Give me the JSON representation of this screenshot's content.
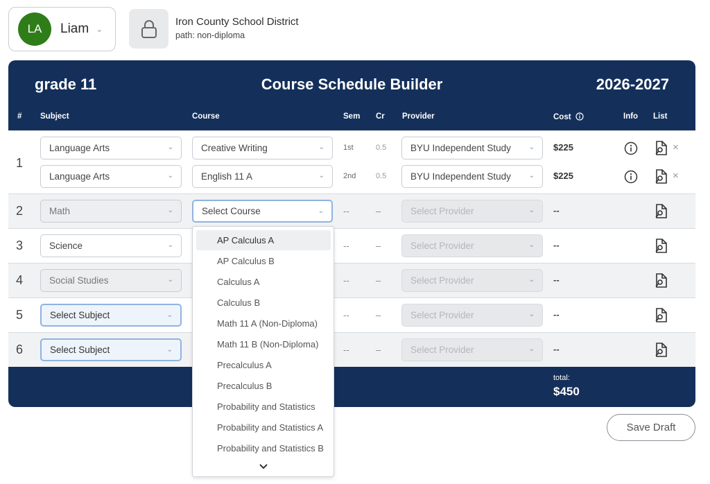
{
  "user": {
    "initials": "LA",
    "name": "Liam",
    "avatar_color": "#2f7d19"
  },
  "district": {
    "name": "Iron County School District",
    "path": "path: non-diploma"
  },
  "header": {
    "grade": "grade 11",
    "title": "Course Schedule Builder",
    "year": "2026-2027"
  },
  "columns": {
    "num": "#",
    "subject": "Subject",
    "course": "Course",
    "sem": "Sem",
    "cr": "Cr",
    "provider": "Provider",
    "cost": "Cost",
    "info": "Info",
    "list": "List"
  },
  "rows": {
    "r1": {
      "num": "1",
      "a": {
        "subject": "Language Arts",
        "course": "Creative Writing",
        "sem": "1st",
        "cr": "0.5",
        "provider": "BYU Independent Study",
        "cost": "$225"
      },
      "b": {
        "subject": "Language Arts",
        "course": "English 11 A",
        "sem": "2nd",
        "cr": "0.5",
        "provider": "BYU Independent Study",
        "cost": "$225"
      }
    },
    "r2": {
      "num": "2",
      "subject": "Math",
      "course": "Select Course",
      "sem": "--",
      "cr": "–",
      "provider": "Select Provider",
      "cost": "--"
    },
    "r3": {
      "num": "3",
      "subject": "Science",
      "sem": "--",
      "cr": "–",
      "provider": "Select Provider",
      "cost": "--"
    },
    "r4": {
      "num": "4",
      "subject": "Social Studies",
      "sem": "--",
      "cr": "–",
      "provider": "Select Provider",
      "cost": "--"
    },
    "r5": {
      "num": "5",
      "subject": "Select Subject",
      "sem": "--",
      "cr": "–",
      "provider": "Select Provider",
      "cost": "--"
    },
    "r6": {
      "num": "6",
      "subject": "Select Subject",
      "sem": "--",
      "cr": "–",
      "provider": "Select Provider",
      "cost": "--"
    }
  },
  "footer": {
    "total_label": "total:",
    "total": "$450"
  },
  "save_label": "Save Draft",
  "dropdown": {
    "options": [
      "AP Calculus A",
      "AP Calculus B",
      "Calculus A",
      "Calculus B",
      "Math 11 A (Non-Diploma)",
      "Math 11 B (Non-Diploma)",
      "Precalculus A",
      "Precalculus B",
      "Probability and Statistics",
      "Probability and Statistics A",
      "Probability and Statistics B"
    ],
    "highlighted": "AP Calculus A"
  },
  "icons": {
    "lock": "lock-icon",
    "info": "info-icon",
    "list": "document-search-icon",
    "remove": "close-icon",
    "chevron": "chevron-down-icon"
  },
  "colors": {
    "navy": "#14305a",
    "focus_border": "#8fb3e0"
  }
}
